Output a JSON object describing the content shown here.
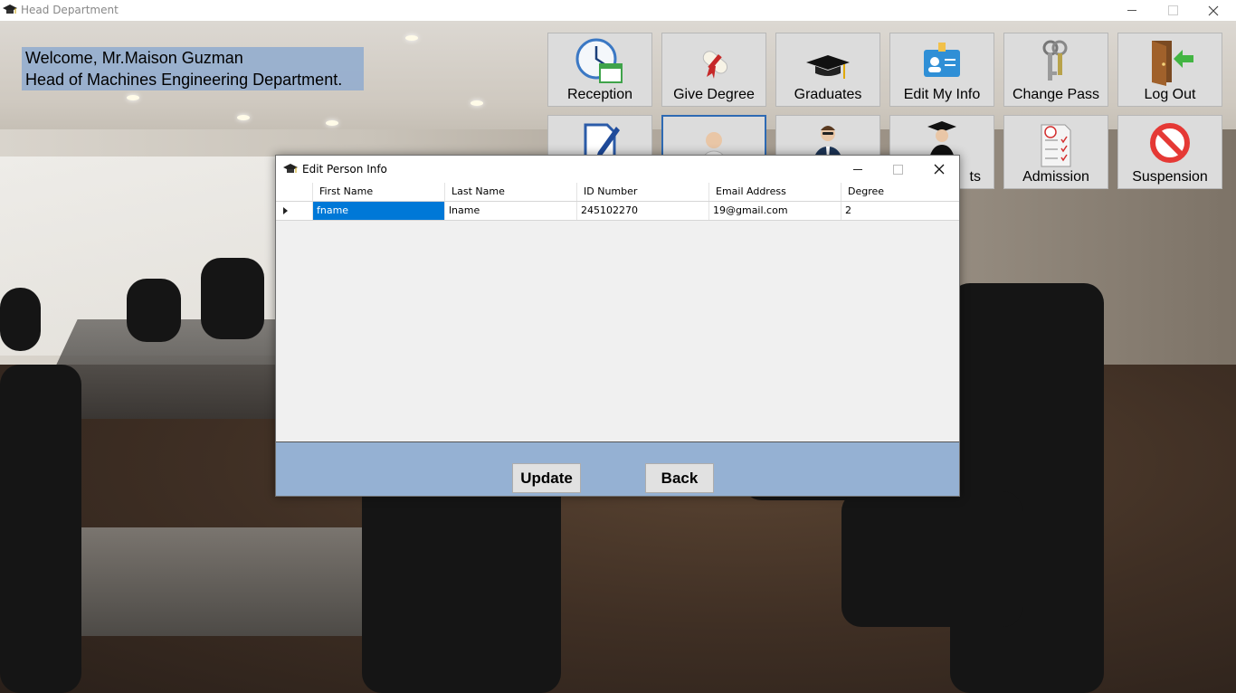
{
  "window": {
    "title": "Head Department"
  },
  "welcome": {
    "line1": "Welcome, Mr.Maison Guzman",
    "line2": "Head of Machines Engineering Department."
  },
  "tiles_row1": [
    {
      "label": "Reception",
      "icon": "calendar-clock-icon"
    },
    {
      "label": "Give Degree",
      "icon": "diploma-icon"
    },
    {
      "label": "Graduates",
      "icon": "graduation-cap-icon"
    },
    {
      "label": "Edit My Info",
      "icon": "id-card-icon"
    },
    {
      "label": "Change Pass",
      "icon": "keys-icon"
    },
    {
      "label": "Log Out",
      "icon": "exit-door-icon"
    }
  ],
  "tiles_row2": [
    {
      "label": "",
      "icon": "document-pen-icon"
    },
    {
      "label": "",
      "icon": "doctor-icon"
    },
    {
      "label": "",
      "icon": "businessman-icon"
    },
    {
      "label": "ts",
      "icon": "graduate-student-icon"
    },
    {
      "label": "Admission",
      "icon": "grade-checklist-icon"
    },
    {
      "label": "Suspension",
      "icon": "no-entry-icon"
    }
  ],
  "dialog": {
    "title": "Edit Person Info",
    "columns": [
      "First Name",
      "Last Name",
      "ID Number",
      "Email Address",
      "Degree"
    ],
    "rows": [
      [
        "fname",
        "lname",
        "245102270",
        "19@gmail.com",
        "2"
      ]
    ],
    "update_label": "Update",
    "back_label": "Back"
  },
  "colors": {
    "accent": "#95b1d3",
    "selection": "#0078d7"
  }
}
